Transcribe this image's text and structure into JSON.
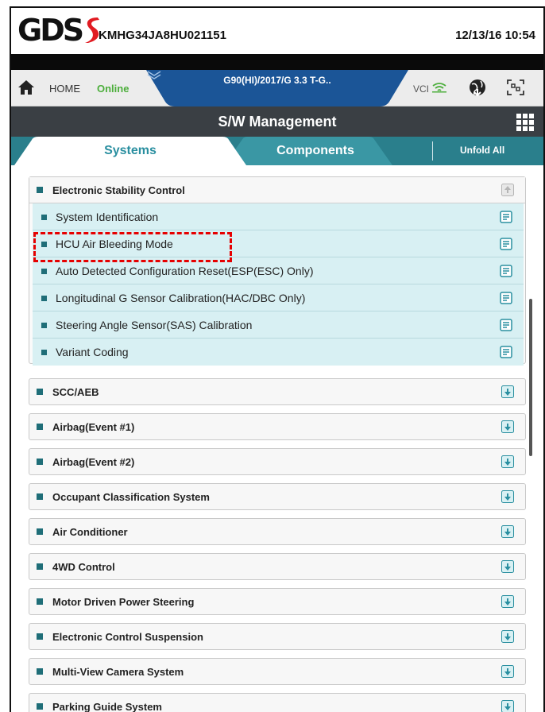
{
  "titlebar": {
    "logo": "GDS",
    "vin": "KMHG34JA8HU021151",
    "datetime": "12/13/16 10:54"
  },
  "navbar": {
    "home_label": "HOME",
    "status": "Online",
    "vehicle": "G90(HI)/2017/G 3.3 T-G..",
    "vci_label": "VCI"
  },
  "header": {
    "title": "S/W Management"
  },
  "tabs": {
    "systems": "Systems",
    "components": "Components",
    "unfold_all": "Unfold All"
  },
  "colors": {
    "teal": "#2a7f8c",
    "dark_header": "#3a3f44",
    "online_green": "#4cae3b",
    "sub_item_bg": "#d8f0f3",
    "highlight_red": "#e60000"
  },
  "expanded_group": {
    "label": "Electronic Stability Control",
    "items": [
      "System Identification",
      "HCU Air Bleeding Mode",
      "Auto Detected Configuration Reset(ESP(ESC) Only)",
      "Longitudinal G Sensor Calibration(HAC/DBC Only)",
      "Steering Angle Sensor(SAS) Calibration",
      "Variant Coding"
    ]
  },
  "collapsed_groups": [
    "SCC/AEB",
    "Airbag(Event #1)",
    "Airbag(Event #2)",
    "Occupant Classification System",
    "Air Conditioner",
    "4WD Control",
    "Motor Driven Power Steering",
    "Electronic Control Suspension",
    "Multi-View Camera System",
    "Parking Guide System"
  ]
}
